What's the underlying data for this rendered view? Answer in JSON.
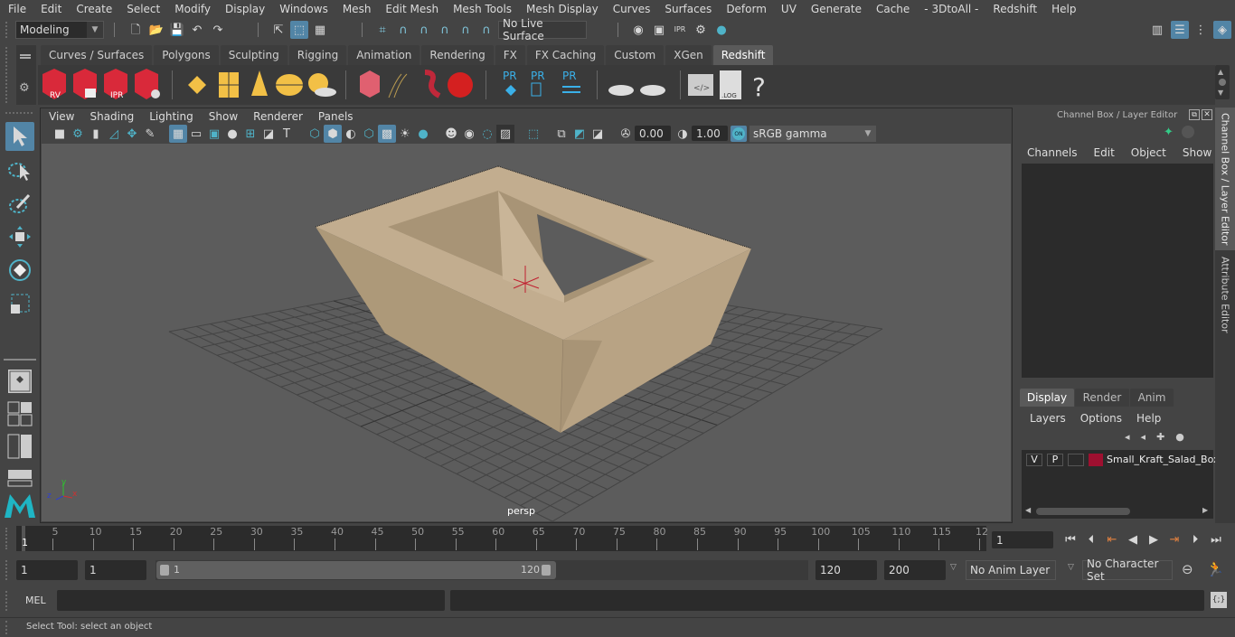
{
  "menubar": {
    "items": [
      "File",
      "Edit",
      "Create",
      "Select",
      "Modify",
      "Display",
      "Windows",
      "Mesh",
      "Edit Mesh",
      "Mesh Tools",
      "Mesh Display",
      "Curves",
      "Surfaces",
      "Deform",
      "UV",
      "Generate",
      "Cache",
      "- 3DtoAll -",
      "Redshift",
      "Help"
    ]
  },
  "toolbar": {
    "mode_dropdown": "Modeling",
    "live_surface": "No Live Surface"
  },
  "shelf": {
    "tabs": [
      "Curves / Surfaces",
      "Polygons",
      "Sculpting",
      "Rigging",
      "Animation",
      "Rendering",
      "FX",
      "FX Caching",
      "Custom",
      "XGen",
      "Redshift"
    ],
    "active_tab": "Redshift",
    "icons": [
      {
        "name": "redshift-render-view-icon",
        "label": "RV"
      },
      {
        "name": "redshift-batch-render-icon",
        "label": ""
      },
      {
        "name": "redshift-ipr-icon",
        "label": "IPR"
      },
      {
        "name": "redshift-render-settings-icon",
        "label": ""
      },
      {
        "name": "redshift-area-light-icon",
        "label": ""
      },
      {
        "name": "redshift-portal-light-icon",
        "label": ""
      },
      {
        "name": "redshift-spot-light-icon",
        "label": ""
      },
      {
        "name": "redshift-dome-light-icon",
        "label": ""
      },
      {
        "name": "redshift-sun-sky-icon",
        "label": ""
      },
      {
        "name": "redshift-proxy-icon",
        "label": ""
      },
      {
        "name": "redshift-hair-icon",
        "label": ""
      },
      {
        "name": "redshift-volume-icon",
        "label": ""
      },
      {
        "name": "redshift-sphere-icon",
        "label": ""
      },
      {
        "name": "pr-import-icon",
        "label": "PR"
      },
      {
        "name": "pr-export-icon",
        "label": "PR"
      },
      {
        "name": "pr-swap-icon",
        "label": "PR"
      },
      {
        "name": "bake-set-icon",
        "label": ""
      },
      {
        "name": "bake-icon",
        "label": ""
      },
      {
        "name": "script-editor-icon",
        "label": ""
      },
      {
        "name": "log-icon",
        "label": "LOG"
      },
      {
        "name": "help-icon",
        "label": "?"
      }
    ]
  },
  "viewport": {
    "menu": [
      "View",
      "Shading",
      "Lighting",
      "Show",
      "Renderer",
      "Panels"
    ],
    "exposure": "0.00",
    "gamma": "1.00",
    "color_toggle": "ON",
    "color_space": "sRGB gamma",
    "camera_label": "persp",
    "axis": {
      "x": "x",
      "y": "y",
      "z": "z"
    }
  },
  "right_panel": {
    "title": "Channel Box / Layer Editor",
    "channel_menu": [
      "Channels",
      "Edit",
      "Object",
      "Show"
    ],
    "layer_tabs": [
      "Display",
      "Render",
      "Anim"
    ],
    "active_layer_tab": "Display",
    "layer_menu": [
      "Layers",
      "Options",
      "Help"
    ],
    "layers": [
      {
        "v": "V",
        "p": "P",
        "color": "#9e1030",
        "name": "Small_Kraft_Salad_Box_"
      }
    ]
  },
  "side_tabs": [
    "Channel Box / Layer Editor",
    "Attribute Editor"
  ],
  "timeline": {
    "ticks": [
      "5",
      "10",
      "15",
      "20",
      "25",
      "30",
      "35",
      "40",
      "45",
      "50",
      "55",
      "60",
      "65",
      "70",
      "75",
      "80",
      "85",
      "90",
      "95",
      "100",
      "105",
      "110",
      "115",
      "12"
    ],
    "current_frame_marker": "1",
    "current_frame": "1"
  },
  "range": {
    "start": "1",
    "playback_start": "1",
    "slider_start": "1",
    "slider_end": "120",
    "playback_end": "120",
    "end": "200",
    "anim_layer": "No Anim Layer",
    "character_set": "No Character Set"
  },
  "command": {
    "language": "MEL"
  },
  "status": {
    "message": "Select Tool: select an object"
  }
}
